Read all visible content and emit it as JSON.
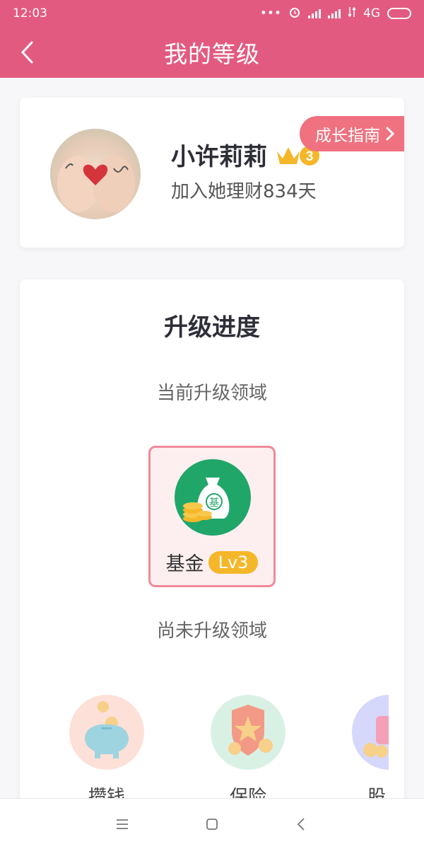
{
  "status_bar": {
    "time": "12:03",
    "dots": "•••",
    "network": "4G"
  },
  "header": {
    "title": "我的等级"
  },
  "profile": {
    "username": "小许莉莉",
    "crown_level": "3",
    "joined_text": "加入她理财834天",
    "guide_button": "成长指南"
  },
  "progress": {
    "title": "升级进度",
    "current_label": "当前升级领域",
    "current_domain": {
      "name": "基金",
      "level": "Lv3",
      "icon": "money-bag-icon",
      "icon_text": "基"
    },
    "pending_label": "尚未升级领域",
    "pending_domains": [
      {
        "name": "攒钱",
        "icon": "piggy-bank-icon"
      },
      {
        "name": "保险",
        "icon": "shield-star-icon"
      },
      {
        "name": "股",
        "icon": "stock-icon"
      }
    ]
  },
  "colors": {
    "brand": "#e35a80",
    "badge": "#f5b72a",
    "guide": "#f0717f",
    "fund_green": "#21a66a"
  }
}
